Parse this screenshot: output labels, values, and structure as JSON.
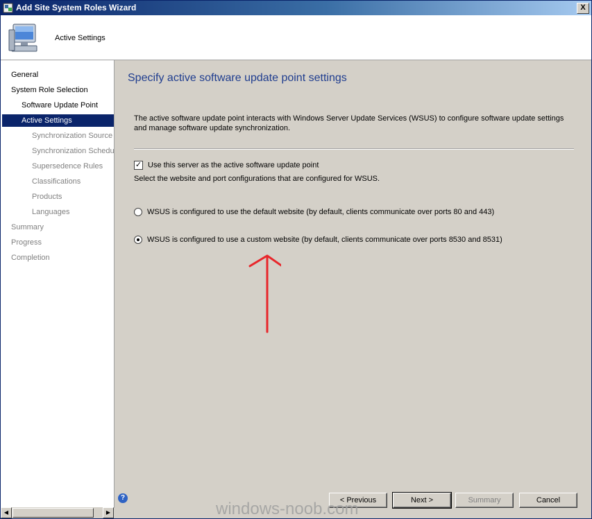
{
  "window": {
    "title": "Add Site System Roles Wizard",
    "close_glyph": "X"
  },
  "header": {
    "title": "Active Settings"
  },
  "nav": {
    "items": [
      {
        "label": "General",
        "indent": 0,
        "state": "normal"
      },
      {
        "label": "System Role Selection",
        "indent": 0,
        "state": "normal"
      },
      {
        "label": "Software Update Point",
        "indent": 1,
        "state": "normal"
      },
      {
        "label": "Active Settings",
        "indent": 1,
        "state": "active"
      },
      {
        "label": "Synchronization Source",
        "indent": 2,
        "state": "dim"
      },
      {
        "label": "Synchronization Schedule",
        "indent": 2,
        "state": "dim"
      },
      {
        "label": "Supersedence Rules",
        "indent": 2,
        "state": "dim"
      },
      {
        "label": "Classifications",
        "indent": 2,
        "state": "dim"
      },
      {
        "label": "Products",
        "indent": 2,
        "state": "dim"
      },
      {
        "label": "Languages",
        "indent": 2,
        "state": "dim"
      },
      {
        "label": "Summary",
        "indent": 0,
        "state": "dim"
      },
      {
        "label": "Progress",
        "indent": 0,
        "state": "dim"
      },
      {
        "label": "Completion",
        "indent": 0,
        "state": "dim"
      }
    ]
  },
  "content": {
    "title": "Specify active software update point settings",
    "description": "The active software update point interacts with Windows Server Update Services (WSUS) to configure software update settings and manage software update synchronization.",
    "checkbox_label": "Use this server as the active software update point",
    "checkbox_checked": true,
    "select_text": "Select the website and port configurations that are configured for WSUS.",
    "radio_default_label": "WSUS is configured to use the default website (by default, clients communicate over ports 80 and 443)",
    "radio_custom_label": "WSUS is configured to use a custom website (by default, clients communicate over ports 8530 and 8531)",
    "selected_radio": "custom"
  },
  "footer": {
    "help_glyph": "?",
    "previous_label": "< Previous",
    "next_label": "Next >",
    "summary_label": "Summary",
    "cancel_label": "Cancel"
  },
  "watermark": "windows-noob.com",
  "colors": {
    "accent": "#0a246a",
    "title_text": "#1f3d8f",
    "arrow": "#e8262b"
  },
  "icons": {
    "title": "wizard-icon",
    "header": "computer-icon",
    "help": "help-icon"
  }
}
